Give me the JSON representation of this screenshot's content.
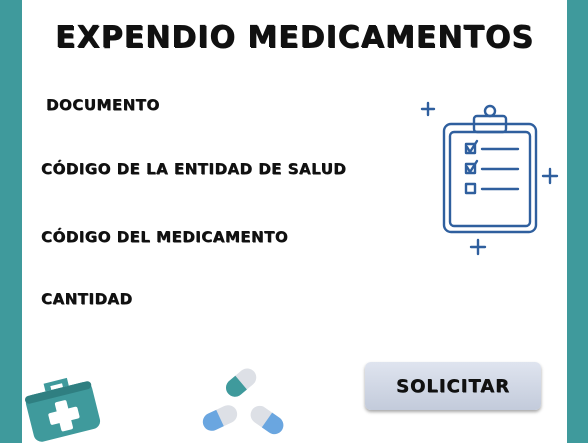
{
  "title": "EXPENDIO MEDICAMENTOS",
  "fields": {
    "documento": "DOCUMENTO",
    "entidad": "CÓDIGO DE LA ENTIDAD DE SALUD",
    "medicamento": "CÓDIGO DEL MEDICAMENTO",
    "cantidad": "CANTIDAD"
  },
  "submit_label": "SOLICITAR",
  "icons": {
    "clipboard": "clipboard-checklist-icon",
    "first_aid": "first-aid-kit-icon",
    "pills": "pills-icon"
  },
  "colors": {
    "background": "#3f9a9c",
    "panel": "#ffffff",
    "clipboard_stroke": "#2f5f9e",
    "kit": "#3f9a9c",
    "pill_blue": "#6aa6e0",
    "pill_teal": "#3f9a9c",
    "pill_gray": "#dde0e6"
  }
}
